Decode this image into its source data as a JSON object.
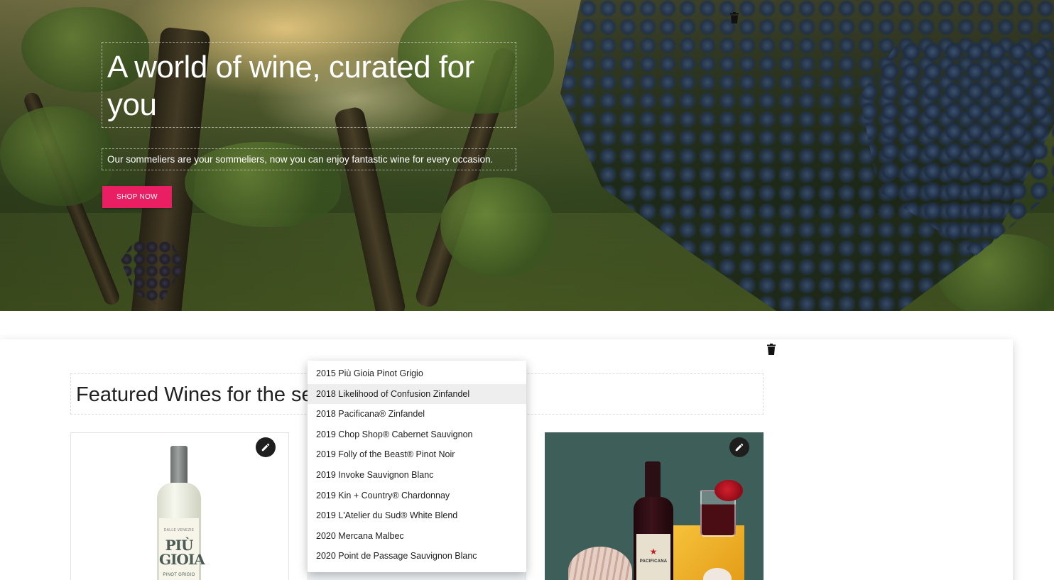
{
  "hero": {
    "title": "A world of wine, curated for you",
    "subtitle": "Our sommeliers are your sommeliers, now you can enjoy fantastic wine for every occasion.",
    "shop_button": "SHOP NOW"
  },
  "featured": {
    "title": "Featured Wines for the season"
  },
  "cards": [
    {
      "bottle_label": "PIÙ GIOIA",
      "bottle_small_text": "DALLE VENEZIE",
      "bottle_varietal": "PINOT GRIGIO"
    },
    {},
    {
      "bottle_label": "PACIFICANA"
    }
  ],
  "dropdown": {
    "items": [
      {
        "label": "2015 Più Gioia Pinot Grigio",
        "highlighted": false
      },
      {
        "label": "2018 Likelihood of Confusion Zinfandel",
        "highlighted": true
      },
      {
        "label": "2018 Pacificana® Zinfandel",
        "highlighted": false
      },
      {
        "label": "2019 Chop Shop® Cabernet Sauvignon",
        "highlighted": false
      },
      {
        "label": "2019 Folly of the Beast® Pinot Noir",
        "highlighted": false
      },
      {
        "label": "2019 Invoke Sauvignon Blanc",
        "highlighted": false
      },
      {
        "label": "2019 Kin + Country® Chardonnay",
        "highlighted": false
      },
      {
        "label": "2019 L'Atelier du Sud® White Blend",
        "highlighted": false
      },
      {
        "label": "2020 Mercana Malbec",
        "highlighted": false
      },
      {
        "label": "2020 Point de Passage Sauvignon Blanc",
        "highlighted": false
      }
    ]
  },
  "icons": {
    "trash": "trash-icon",
    "edit": "pencil-icon"
  },
  "colors": {
    "accent": "#e91e63",
    "highlight_row": "#eeeeee",
    "edit_button": "#1e1e1e",
    "card3_background": "#3e5e5a"
  }
}
